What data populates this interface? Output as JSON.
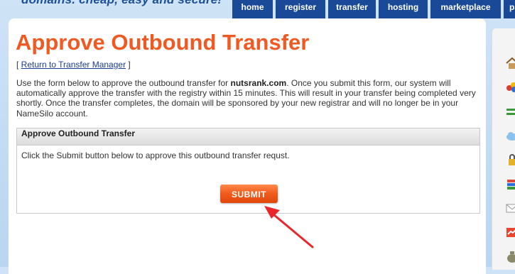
{
  "header": {
    "tagline": "domains. cheap, easy and secure!",
    "nav": [
      {
        "label": "home"
      },
      {
        "label": "register"
      },
      {
        "label": "transfer"
      },
      {
        "label": "hosting"
      },
      {
        "label": "marketplace"
      },
      {
        "label": "pr"
      }
    ]
  },
  "page": {
    "title": "Approve Outbound Transfer",
    "return_prefix": "[ ",
    "return_link": "Return to Transfer Manager",
    "return_suffix": " ]",
    "intro_1": "Use the form below to approve the outbound transfer for ",
    "intro_domain": "nutsrank.com",
    "intro_2": ". Once you submit this form, our system will automatically approve the transfer with the registry within 15 minutes. This will result in your transfer being completed very shortly. Once the transfer completes, the domain will be sponsored by your new registrar and will no longer be in your NameSilo account."
  },
  "panel": {
    "header": "Approve Outbound Transfer",
    "message": "Click the Submit button below to approve this outbound transfer requst.",
    "submit_label": "SUBMIT"
  },
  "sidebar_icons": [
    "home-icon",
    "domains-icon",
    "transfer-arrows-icon",
    "cloud-icon",
    "lock-icon",
    "stack-icon",
    "mail-icon",
    "chart-icon",
    "money-bag-icon"
  ],
  "colors": {
    "accent": "#f05a22",
    "nav": "#1a4a97",
    "annotation_arrow": "#e8262b"
  }
}
